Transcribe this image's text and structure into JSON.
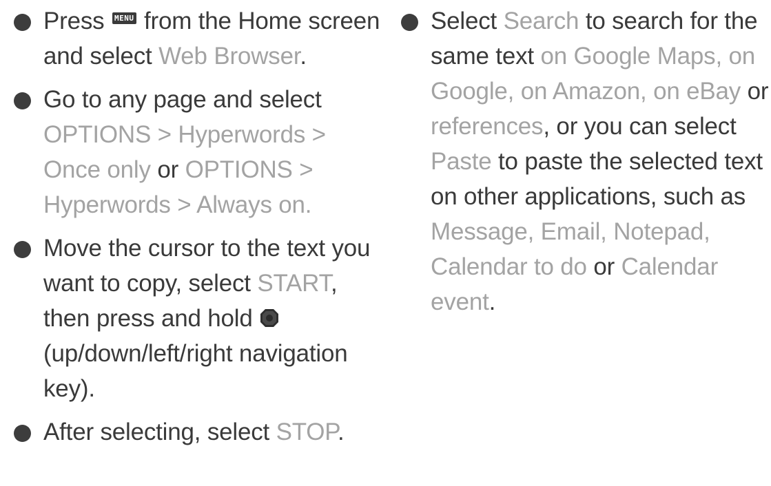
{
  "left_column": {
    "items": [
      {
        "parts": [
          {
            "t": "Press ",
            "hl": false
          },
          {
            "icon": "menu-key",
            "label": "MENU"
          },
          {
            "t": " from the Home screen and select ",
            "hl": false
          },
          {
            "t": "Web Browser",
            "hl": true
          },
          {
            "t": ".",
            "hl": false
          }
        ]
      },
      {
        "parts": [
          {
            "t": "Go to any page and select ",
            "hl": false
          },
          {
            "t": "OPTIONS > Hyperwords > Once only",
            "hl": true
          },
          {
            "t": " or ",
            "hl": false
          },
          {
            "t": "OPTIONS > Hyperwords > Always on.",
            "hl": true
          }
        ]
      },
      {
        "parts": [
          {
            "t": "Move the cursor to the text you want to copy, select ",
            "hl": false
          },
          {
            "t": "START",
            "hl": true
          },
          {
            "t": ", then press and hold ",
            "hl": false
          },
          {
            "icon": "navigation-key-icon"
          },
          {
            "t": "(up/down/left/right navigation key).",
            "hl": false
          }
        ]
      },
      {
        "parts": [
          {
            "t": "After selecting, select ",
            "hl": false
          },
          {
            "t": "STOP",
            "hl": true
          },
          {
            "t": ".",
            "hl": false
          }
        ]
      }
    ]
  },
  "right_column": {
    "items": [
      {
        "parts": [
          {
            "t": "Select ",
            "hl": false
          },
          {
            "t": "Search",
            "hl": true
          },
          {
            "t": " to search for the same text ",
            "hl": false
          },
          {
            "t": "on Google Maps, on Google, on Amazon, on eBay",
            "hl": true
          },
          {
            "t": " or ",
            "hl": false
          },
          {
            "t": "references",
            "hl": true
          },
          {
            "t": ", or you can select ",
            "hl": false
          },
          {
            "t": "Paste",
            "hl": true
          },
          {
            "t": " to paste the selected text on other applications, such as ",
            "hl": false
          },
          {
            "t": "Message, Email, Notepad, Calendar to do",
            "hl": true
          },
          {
            "t": " or ",
            "hl": false
          },
          {
            "t": "Calendar event",
            "hl": true
          },
          {
            "t": ".",
            "hl": false
          }
        ]
      }
    ]
  },
  "colors": {
    "body_text": "#3a3a3a",
    "highlight_text": "#a3a3a3",
    "bullet": "#3d3d3d"
  }
}
